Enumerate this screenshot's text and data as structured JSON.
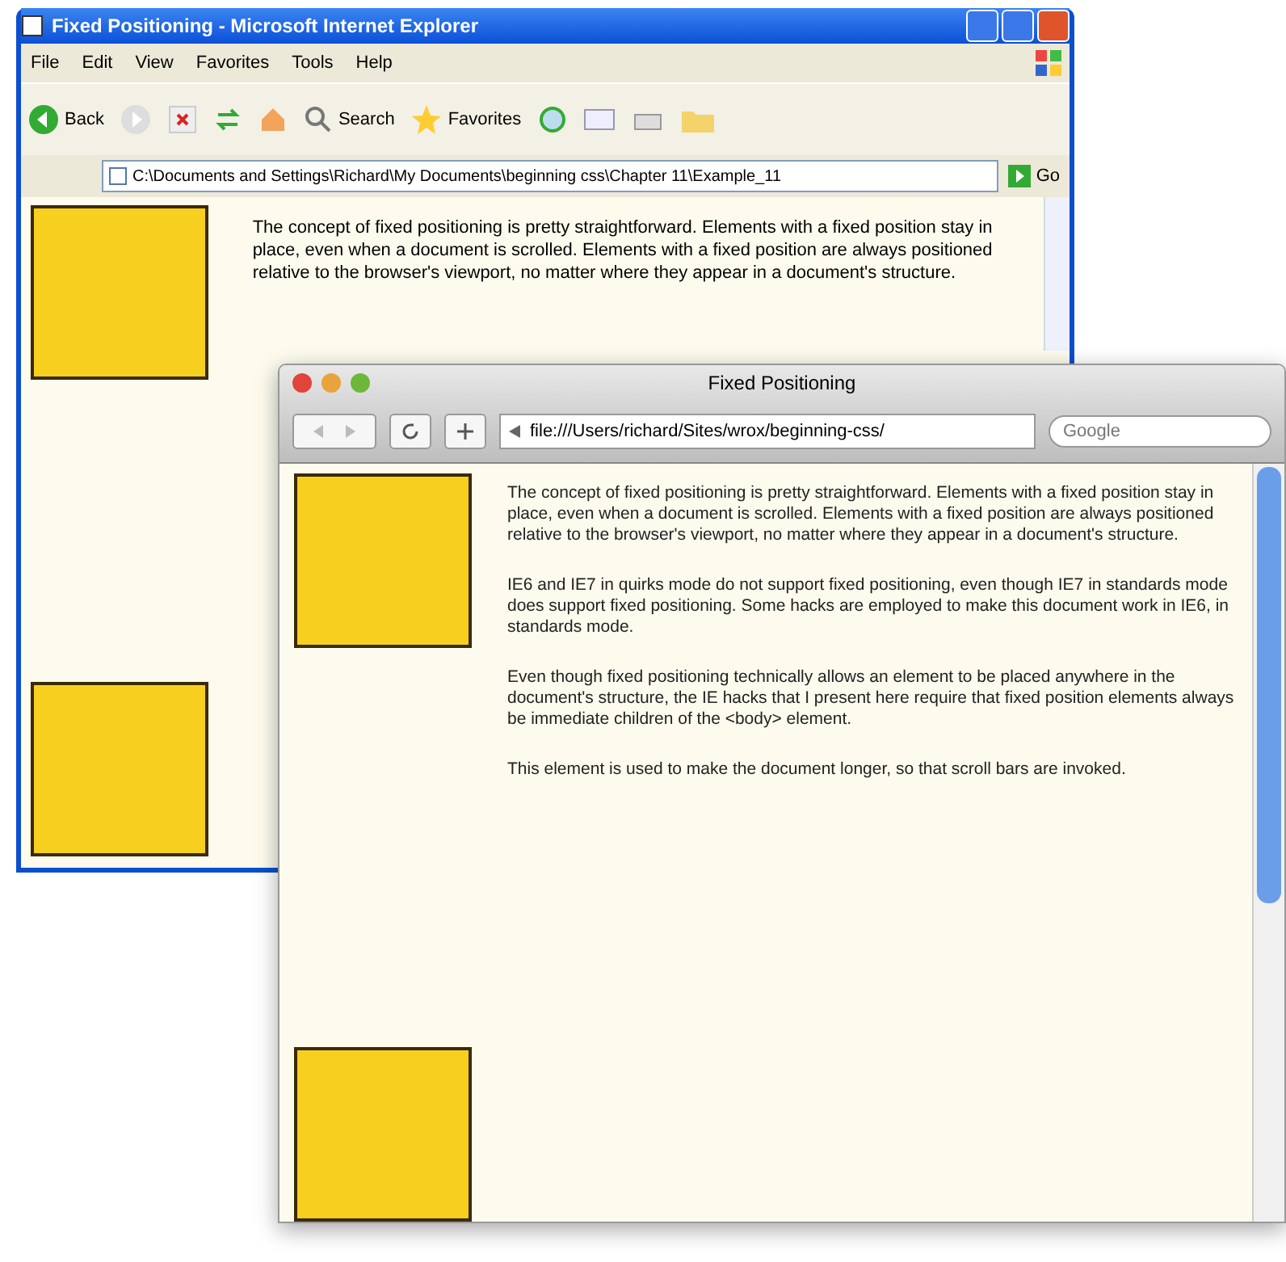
{
  "ie_window": {
    "title": "Fixed Positioning - Microsoft Internet Explorer",
    "menu": [
      "File",
      "Edit",
      "View",
      "Favorites",
      "Tools",
      "Help"
    ],
    "toolbar": [
      {
        "kind": "back",
        "label": "Back"
      },
      {
        "kind": "search",
        "label": "Search"
      },
      {
        "kind": "favorites",
        "label": "Favorites"
      }
    ],
    "address": "C:\\Documents and Settings\\Richard\\My Documents\\beginning css\\Chapter 11\\Example_11",
    "go_button": "Go",
    "paragraphs": [
      "The concept of fixed positioning is pretty straightforward. Elements with a fixed position stay in place, even when a document is scrolled. Elements with a fixed position are always positioned relative to the browser's viewport, no matter where they appear in a document's structure."
    ]
  },
  "safari_window": {
    "title": "Fixed Positioning",
    "address": "file:///Users/richard/Sites/wrox/beginning-css/",
    "search": {
      "placeholder": "Google"
    },
    "paragraphs": [
      "The concept of fixed positioning is pretty straightforward. Elements with a fixed position stay in place, even when a document is scrolled. Elements with a fixed position are always positioned relative to the browser's viewport, no matter where they appear in a document's structure.",
      "IE6 and IE7 in quirks mode do not support fixed positioning, even though IE7 in standards mode does support fixed positioning. Some hacks are employed to make this document work in IE6, in standards mode.",
      "Even though fixed positioning technically allows an element to be placed anywhere in the document's structure, the IE hacks that I present here require that fixed position elements always be immediate children of the <body> element.",
      "This element is used to make the document longer, so that scroll bars are invoked."
    ]
  }
}
